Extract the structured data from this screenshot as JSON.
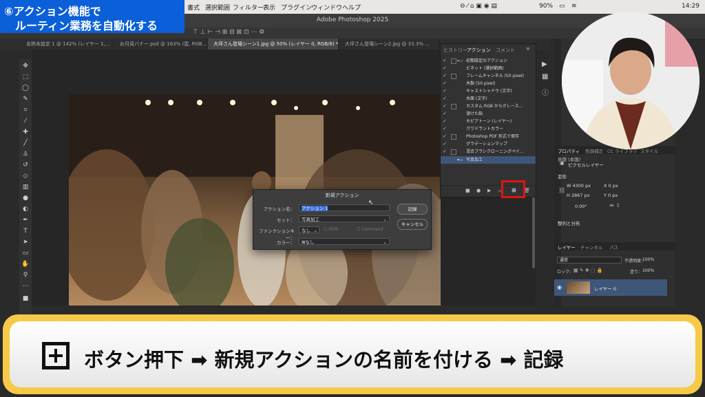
{
  "menubar": {
    "items": [
      "書式",
      "選択範囲",
      "フィルター",
      "表示",
      "プラグイン",
      "ウィンドウ",
      "ヘルプ"
    ],
    "battery": "90%",
    "clock": "14:29"
  },
  "window": {
    "title": "Adobe Photoshop 2025"
  },
  "tabs": [
    {
      "label": "名称未設定 1 @ 142% (レイヤー 1,..."
    },
    {
      "label": "お月見バナー.psd @ 163% (雲, RGB..."
    },
    {
      "label": "大坪さん登場シーン1.jpg @ 50% (レイヤー 0, RGB/8) *"
    },
    {
      "label": "大坪さん登場シーン2.jpg @ 33.3% ..."
    }
  ],
  "actions_panel": {
    "tabs": [
      "ヒストリー",
      "アクション",
      "コメント"
    ],
    "set_name": "初期設定のアクション",
    "actions": [
      "ビネット (選択範囲)",
      "フレームチャンネル (50 pixel)",
      "木製 (50 pixel)",
      "キャストシャドウ (文字)",
      "水面 (文字)",
      "カスタム RGB からグレース...",
      "溶けた鉛",
      "セピアトーン (レイヤー)",
      "クワドラントカラー",
      "Photoshop PDF 形式で保存",
      "グラデーションマップ",
      "混合ブラシクローニングペイ..."
    ],
    "new_set": "写真加工"
  },
  "dialog": {
    "title": "新規アクション",
    "name_label": "アクション名：",
    "name_value": "アクション 1",
    "set_label": "セット：",
    "set_value": "写真加工",
    "fkey_label": "ファンクションキー：",
    "fkey_value": "なし",
    "shift": "Shift",
    "command": "Command",
    "color_label": "カラー：",
    "color_value": "なし",
    "record_button": "記録",
    "cancel_button": "キャンセル"
  },
  "properties_panel": {
    "tabs": [
      "プロパティ",
      "色調補正",
      "CC ライブラリ",
      "スタイル"
    ],
    "pixel_layer": "ピクセルレイヤー",
    "transform": "変形",
    "w": "W 4300 px",
    "h": "H 2867 px",
    "x": "X 0 px",
    "y": "Y 0 px",
    "angle": "0.00°",
    "align": "整列と分布",
    "font_label": "見隠 (本国)"
  },
  "layers_panel": {
    "tabs": [
      "レイヤー",
      "チャンネル",
      "パス"
    ],
    "blend": "通常",
    "opacity_label": "不透明度：",
    "opacity": "100%",
    "lock_label": "ロック：",
    "fill_label": "塗り：",
    "fill": "100%",
    "layer_name": "レイヤー 0"
  },
  "banner": {
    "line1": "⑥アクション機能で",
    "line2": "ルーティン業務を自動化する"
  },
  "caption": {
    "text": "ボタン押下 ➡ 新規アクションの名前を付ける ➡ 記録"
  },
  "colors": {
    "banner_blue": "#0b5fd8",
    "caption_border": "#f6c948",
    "highlight_red": "#e0140f"
  }
}
